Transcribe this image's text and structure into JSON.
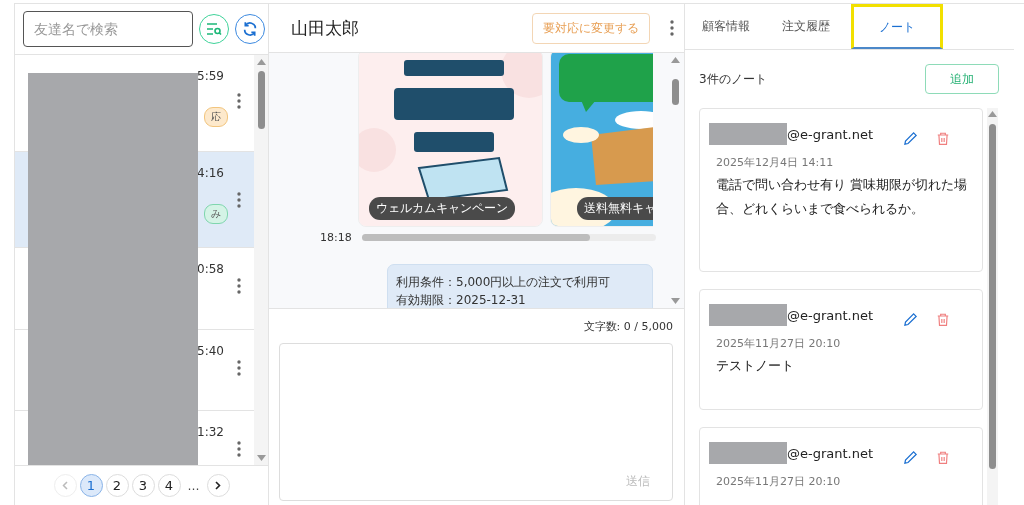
{
  "friends": {
    "search": {
      "placeholder": "友達名で検索"
    },
    "rows": [
      {
        "time": "5:59",
        "badge": {
          "text": "応",
          "kind": "pending"
        },
        "selected": false
      },
      {
        "time": "4:16",
        "badge": {
          "text": "み",
          "kind": "done"
        },
        "selected": true
      },
      {
        "time": "0:58",
        "selected": false
      },
      {
        "time": "5:40",
        "selected": false
      },
      {
        "time": "1:32",
        "selected": false
      }
    ],
    "pagination": {
      "pages": [
        {
          "label": "1",
          "selected": true
        },
        {
          "label": "2",
          "selected": false
        },
        {
          "label": "3",
          "selected": false
        },
        {
          "label": "4",
          "selected": false
        }
      ],
      "ellipsis": "…"
    }
  },
  "chat": {
    "title": "山田太郎",
    "status_button": "要対応に変更する",
    "cards": [
      {
        "caption": "ウェルカムキャンペーン",
        "kind": "coupon"
      },
      {
        "caption": "送料無料キャ",
        "kind": "delivery"
      }
    ],
    "card_time": "18:18",
    "message": [
      "利用条件：5,000円以上の注文で利用可",
      "有効期限：2025-12-31"
    ],
    "char_count": "文字数: 0 / 5,000",
    "send_button": "送信"
  },
  "side": {
    "tabs": [
      {
        "label": "顧客情報",
        "selected": false,
        "highlighted": false
      },
      {
        "label": "注文履歴",
        "selected": false,
        "highlighted": false
      },
      {
        "label": "ノート",
        "selected": true,
        "highlighted": true
      }
    ],
    "notes_count": "3件のノート",
    "add_button": "追加",
    "notes": [
      {
        "email": "@e-grant.net",
        "date": "2025年12月4日 14:11",
        "body": "電話で問い合わせ有り 賞味期限が切れた場合、どれくらいまで食べられるか。"
      },
      {
        "email": "@e-grant.net",
        "date": "2025年11月27日 20:10",
        "body": "テストノート"
      },
      {
        "email": "@e-grant.net",
        "date": "2025年11月27日 20:10"
      }
    ]
  }
}
